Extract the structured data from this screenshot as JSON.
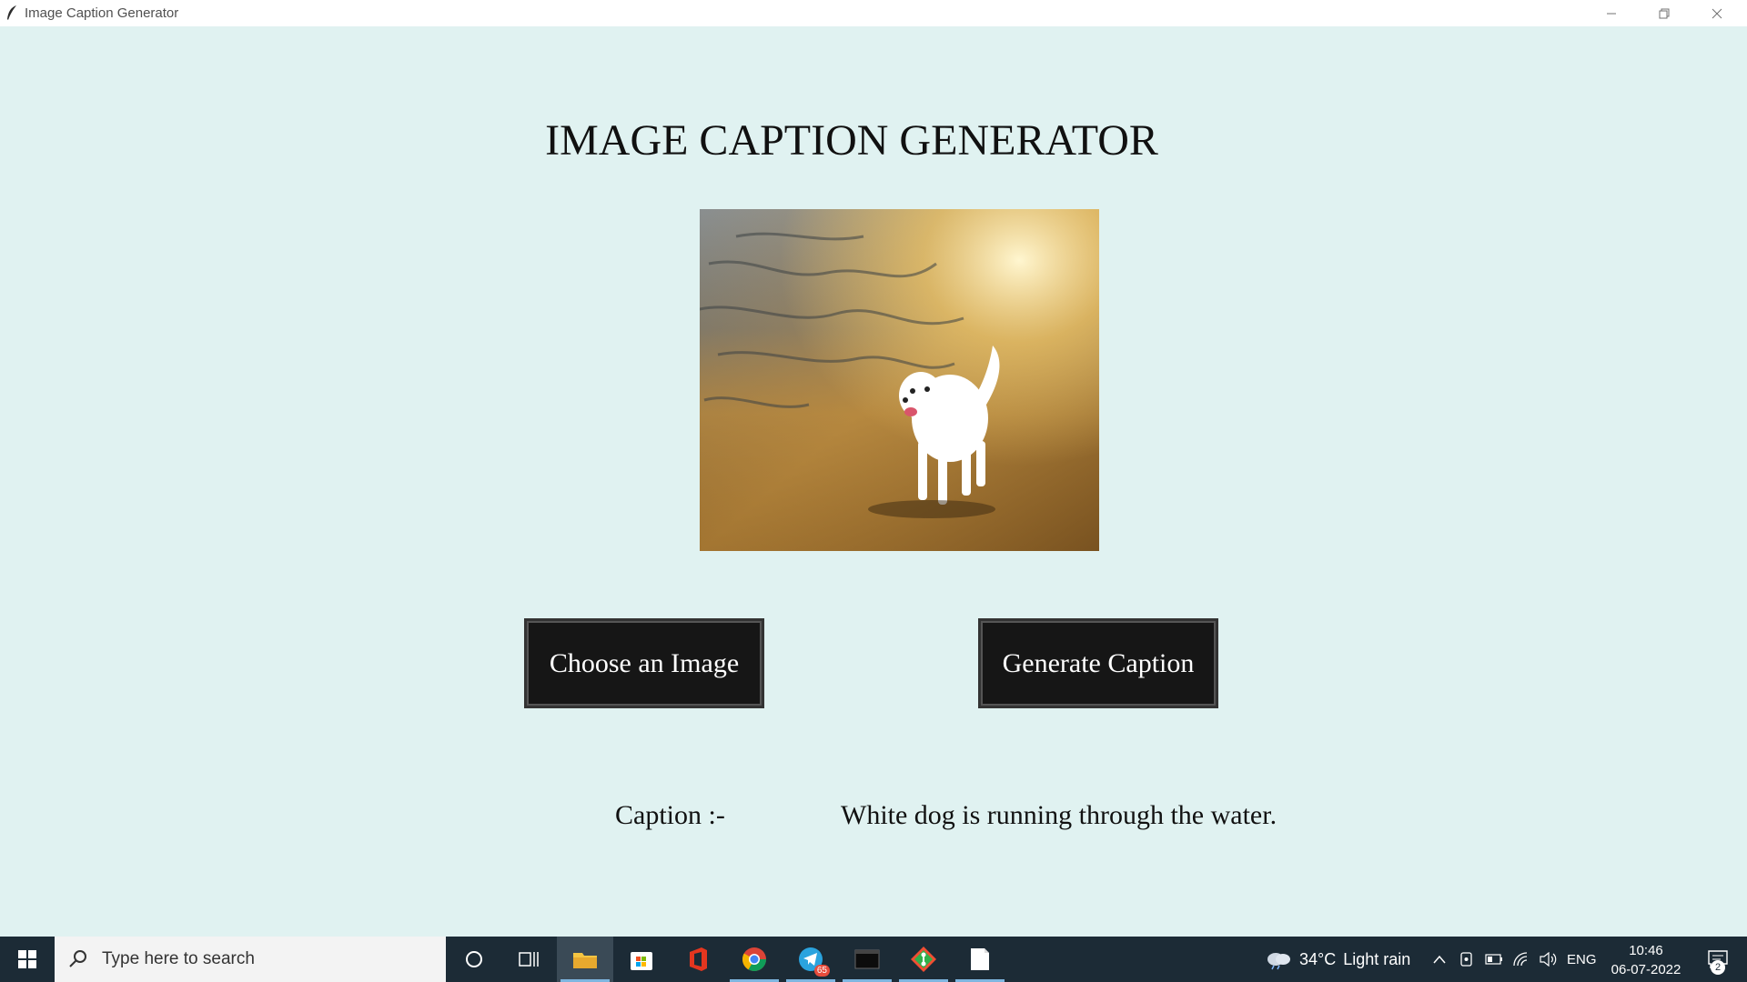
{
  "window": {
    "title": "Image Caption Generator",
    "icon": "feather-icon"
  },
  "app": {
    "heading": "IMAGE CAPTION GENERATOR",
    "image": "dog-on-beach-photo",
    "choose_button": "Choose an Image",
    "generate_button": "Generate Caption",
    "caption_label": "Caption :-",
    "caption_text": "White dog is running through the water."
  },
  "taskbar": {
    "search_placeholder": "Type here to search",
    "apps": [
      "cortana-icon",
      "task-view-icon",
      "file-explorer-icon",
      "store-icon",
      "office-icon",
      "chrome-icon",
      "telegram-icon",
      "terminal-icon",
      "git-icon",
      "notepad-icon"
    ],
    "telegram_badge": "65",
    "weather_temp": "34°C",
    "weather_desc": "Light rain",
    "language": "ENG",
    "time": "10:46",
    "date": "06-07-2022",
    "notification_count": "2"
  },
  "colors": {
    "background": "#e0f2f1",
    "button": "#161616",
    "taskbar": "#1c2b36"
  }
}
